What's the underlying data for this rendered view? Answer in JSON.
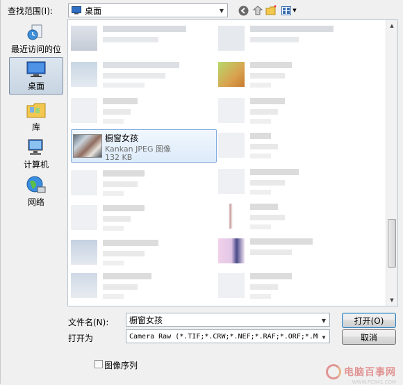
{
  "lookin": {
    "label": "查找范围(I):",
    "value": "桌面"
  },
  "places": [
    {
      "label": "最近访问的位置",
      "icon": "recent-places-icon"
    },
    {
      "label": "桌面",
      "icon": "desktop-icon",
      "selected": true
    },
    {
      "label": "库",
      "icon": "libraries-icon"
    },
    {
      "label": "计算机",
      "icon": "computer-icon"
    },
    {
      "label": "网络",
      "icon": "network-icon"
    }
  ],
  "selected_file": {
    "name": "橱窗女孩",
    "type": "Kankan JPEG 图像",
    "size": "132 KB"
  },
  "filename": {
    "label": "文件名(N):",
    "value": "橱窗女孩"
  },
  "openas": {
    "label": "打开为",
    "value": "Camera Raw (*.TIF;*.CRW;*.NEF;*.RAF;*.ORF;*.MRW;*.D"
  },
  "buttons": {
    "open": "打开(O)",
    "cancel": "取消"
  },
  "image_sequence": {
    "label": "图像序列",
    "checked": false
  },
  "watermark": {
    "text": "电脑百事网",
    "url": "WWW.PC841.COM"
  }
}
